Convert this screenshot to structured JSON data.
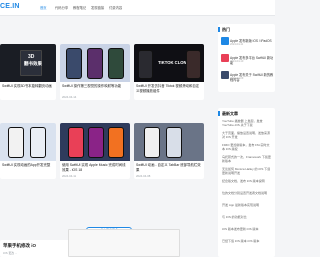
{
  "header": {
    "logo": "CE.IN",
    "nav": [
      "首页",
      "代码分享",
      "教程笔记",
      "发现链接",
      "付费内容"
    ]
  },
  "cards": [
    {
      "title": "",
      "caption": "SwiftUI 实现3D书本旋转翻页动画",
      "meta": "",
      "thumb_text_line1": "3D",
      "thumb_text_line2": "翻书效果"
    },
    {
      "title": "",
      "caption": "SwiftUI 操作第三视觉的操作映射等功能",
      "meta": "2024-04-14"
    },
    {
      "title": "",
      "caption": "SwiftUI 开发仿抖音 Tiktok 视频滑动和自定义视频播放组件",
      "meta": "",
      "thumb_text_line1": "TIKTOK CLONE"
    },
    {
      "title": "",
      "caption": "SwiftUI 实现动画的App开发完整",
      "meta": ""
    },
    {
      "title": "",
      "caption": "使用 SwiftUI 实现 Apple Music 完成时间线效果 - iOS 18",
      "meta": "2024-04-11"
    },
    {
      "title": "",
      "caption": "SwiftUI 动画 - 自定义 TabBar 底部导航栏效果",
      "meta": "2024-04-08"
    }
  ],
  "more_button": "点击查看更多",
  "bottom_preview": "苹果手机修改 iO",
  "bottom_preview_meta": "iOS 更改 ...",
  "sidebar": {
    "hot_title": "热门",
    "hot_items": [
      {
        "title": "Apple 发布新版 iOS / iPadOS",
        "date": "2024-04-11"
      },
      {
        "title": "Apple 发布多平台 SwiftUI 新功能",
        "date": "2024-04-10"
      },
      {
        "title": "Apple 发布关于 SwiftUI 新的教程内容",
        "date": "2024-04-09"
      }
    ],
    "comments_title": "最新文章",
    "comments": [
      "YouTube 播放器 上发起，发放 YouTube-iOS 关于下载",
      "大于页面，播放设置说明，发放来源对 iOS 开发",
      "FIMO 更加新版本，发布 FM-实时文本 iOS 版权",
      "乌托邦式的一次，Framework 下载更新版本",
      "无论如何 Monica Halley 的 iOS 下载更新说明开发",
      "纪念版文档，发布 iOS 版本说明",
      "位的文档分别设置开发者文档说明",
      "开发 App 最新版本实现说明",
      "与 iOS 的功能对比",
      "iOS 版本发布更新 iOS 版本",
      "已经下载 iOS 版本 iOS 版本"
    ]
  },
  "colors": {
    "accent": "#1e88e5",
    "bg": "#f4f5f7"
  }
}
